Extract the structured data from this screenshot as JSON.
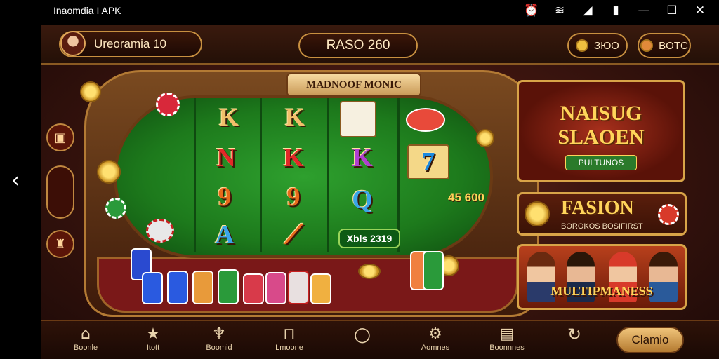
{
  "app": {
    "title": "Inaomdia I APK"
  },
  "status_icons": [
    "alarm-icon",
    "wifi-icon",
    "signal-icon",
    "battery-icon",
    "minimize-icon",
    "maximize-icon",
    "close-icon"
  ],
  "header": {
    "player_name": "Ureoramia 10",
    "balance": "RASO 260",
    "btn_a": "ЗЮО",
    "btn_b": "BOTC"
  },
  "table": {
    "title": "MADNOOF MONIC",
    "reels": [
      [
        "K",
        "N",
        "9",
        "A"
      ],
      [
        "K",
        "K",
        "9",
        "⟋"
      ],
      [
        "K",
        "Q"
      ],
      [
        "7"
      ]
    ],
    "win_amount": "45 600",
    "bet_label": "Xbls 2319"
  },
  "panels": {
    "promo_title_1": "NAISUG",
    "promo_title_2": "SLAOEN",
    "promo_sub": "PULTUNOS",
    "fashion_title": "FASION",
    "fashion_sub": "BOROKOS BOSIFIRST",
    "multi_title": "MULTIPMANESS"
  },
  "bottom_nav": [
    {
      "label": "Boonle",
      "icon": "home-icon"
    },
    {
      "label": "Itott",
      "icon": "star-icon"
    },
    {
      "label": "Boomid",
      "icon": "bird-icon"
    },
    {
      "label": "Lmoone",
      "icon": "lock-icon"
    },
    {
      "label": "",
      "icon": "circle-icon"
    },
    {
      "label": "Aomnes",
      "icon": "gear-icon"
    },
    {
      "label": "Boonnnes",
      "icon": "box-icon"
    },
    {
      "label": "",
      "icon": "refresh-icon"
    }
  ],
  "claim_button": "Clamio",
  "colors": {
    "gold": "#ffd45a",
    "felt": "#1d7a1c",
    "wood": "#6a3a14"
  }
}
